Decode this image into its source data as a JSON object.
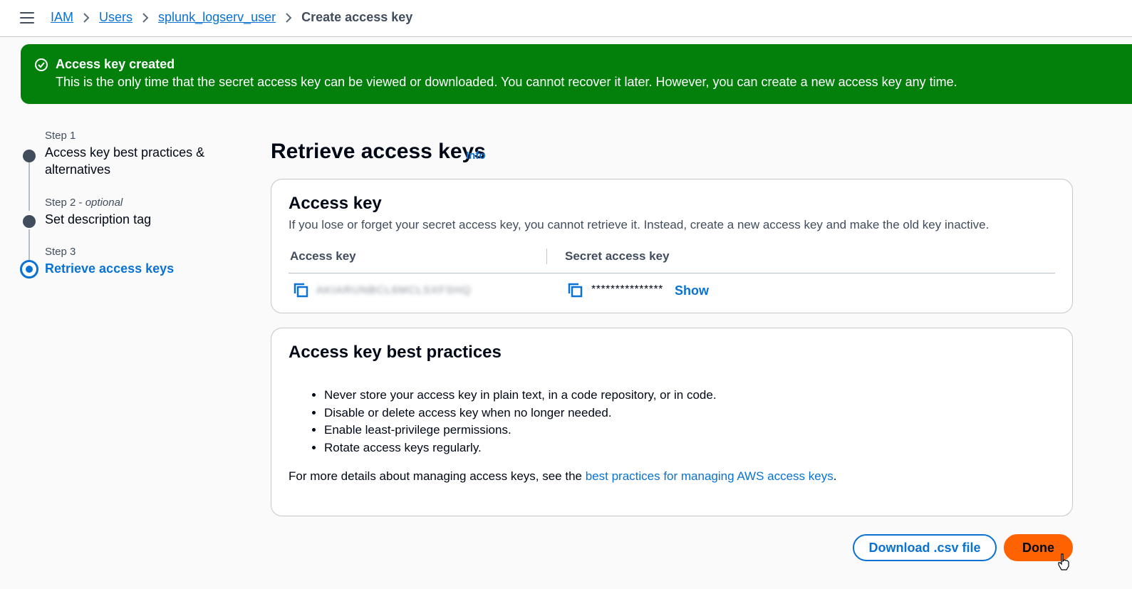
{
  "breadcrumb": {
    "items": [
      "IAM",
      "Users",
      "splunk_logserv_user"
    ],
    "current": "Create access key"
  },
  "banner": {
    "title": "Access key created",
    "message": "This is the only time that the secret access key can be viewed or downloaded. You cannot recover it later. However, you can create a new access key any time.",
    "color": "#037f0c"
  },
  "steps": [
    {
      "label": "Step 1",
      "optional": "",
      "title": "Access key best practices & alternatives",
      "state": "done"
    },
    {
      "label": "Step 2",
      "optional": "optional",
      "title": "Set description tag",
      "state": "done"
    },
    {
      "label": "Step 3",
      "optional": "",
      "title": "Retrieve access keys",
      "state": "active"
    }
  ],
  "main": {
    "title": "Retrieve access keys",
    "info": "Info"
  },
  "access_key_card": {
    "title": "Access key",
    "description": "If you lose or forget your secret access key, you cannot retrieve it. Instead, create a new access key and make the old key inactive.",
    "col_access_key": "Access key",
    "col_secret_key": "Secret access key",
    "access_key_value": "AKIARUNBCL6MCLSXFSHQ",
    "secret_mask": "***************",
    "show": "Show"
  },
  "best_practices_card": {
    "title": "Access key best practices",
    "items": [
      "Never store your access key in plain text, in a code repository, or in code.",
      "Disable or delete access key when no longer needed.",
      "Enable least-privilege permissions.",
      "Rotate access keys regularly."
    ],
    "footer_prefix": "For more details about managing access keys, see the ",
    "footer_link": "best practices for managing AWS access keys",
    "footer_suffix": "."
  },
  "buttons": {
    "download": "Download .csv file",
    "done": "Done"
  },
  "colors": {
    "primary_link": "#0972d3",
    "done_button": "#ff6200"
  }
}
